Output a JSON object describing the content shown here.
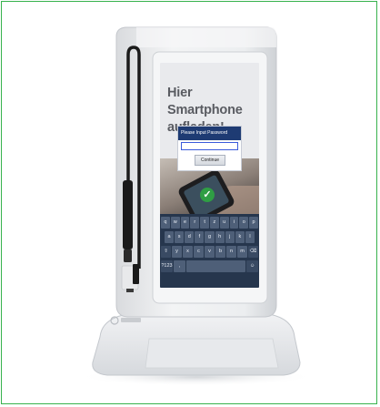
{
  "screen": {
    "headline": "Hier Smartphone aufladen!",
    "dialog": {
      "title": "Please Input Password",
      "input_value": "",
      "button_label": "Continue"
    },
    "keyboard": {
      "row1": [
        "q",
        "w",
        "e",
        "r",
        "t",
        "z",
        "u",
        "i",
        "o",
        "p"
      ],
      "row2": [
        "a",
        "s",
        "d",
        "f",
        "g",
        "h",
        "j",
        "k",
        "l"
      ],
      "row3": [
        "⇧",
        "y",
        "x",
        "c",
        "v",
        "b",
        "n",
        "m",
        "⌫"
      ],
      "row4": [
        "?123",
        ",",
        "",
        "☺"
      ]
    }
  },
  "colors": {
    "frame_border": "#37b24d",
    "dialog_header": "#1e3b73",
    "keyboard_bg": "#26364d",
    "device_body": "#eef0f2"
  },
  "icons": {
    "check": "check-icon",
    "brand_logo": "brand-logo-icon"
  }
}
